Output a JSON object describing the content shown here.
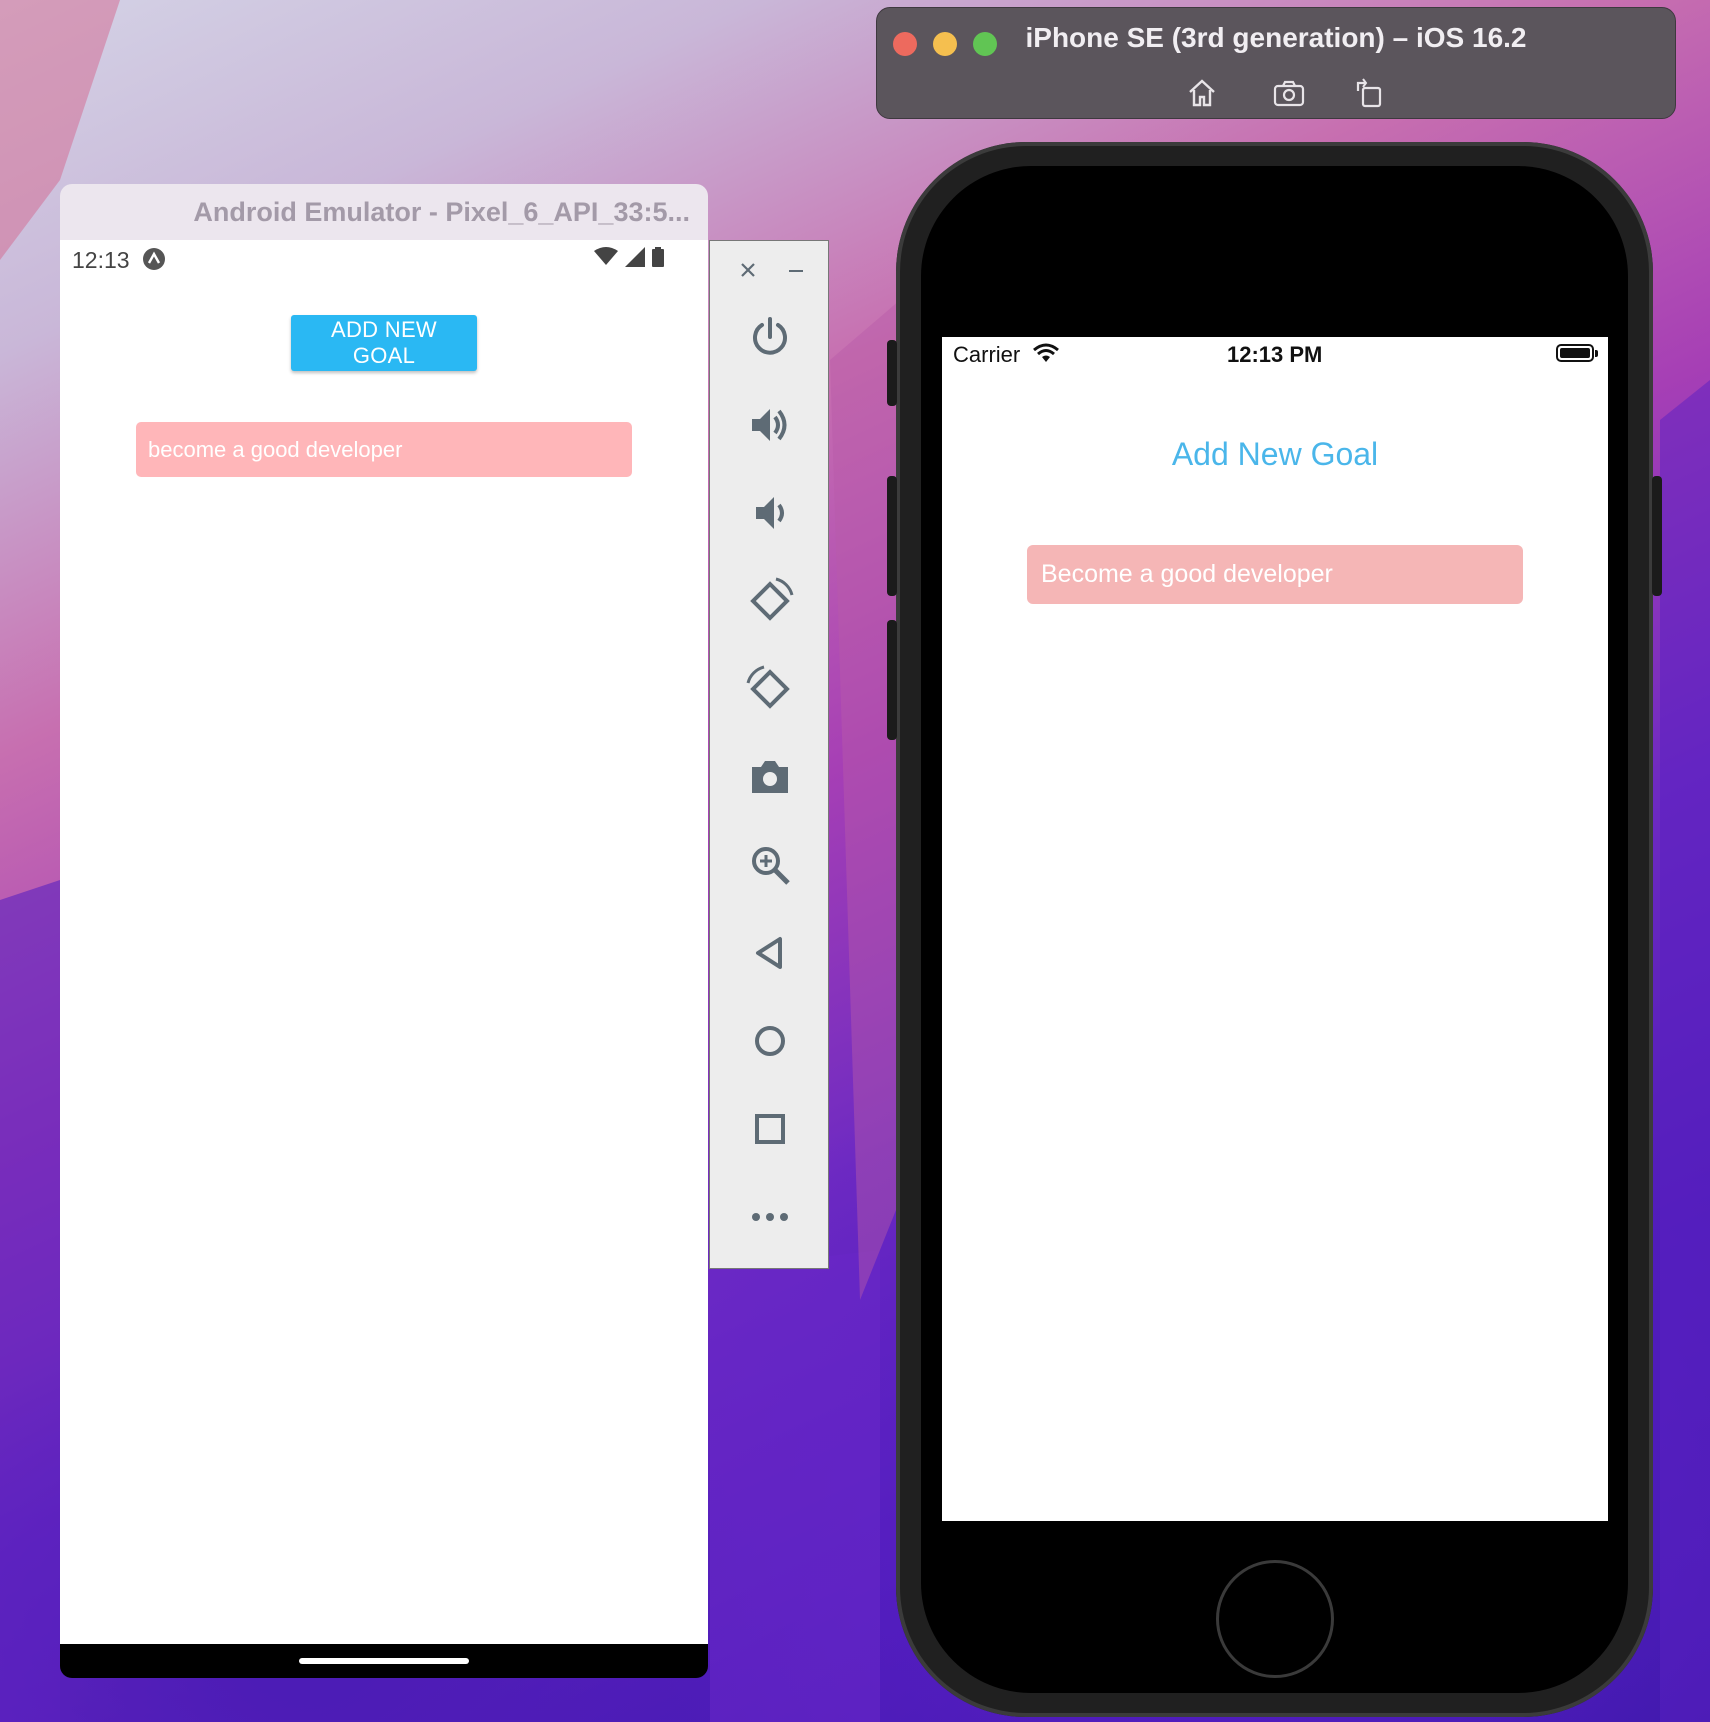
{
  "android": {
    "window_title": "Android Emulator - Pixel_6_API_33:5...",
    "status": {
      "time": "12:13"
    },
    "add_goal_label": "ADD NEW GOAL",
    "goals": [
      "become a good developer"
    ],
    "sidebar": [
      "close-icon",
      "minimize-icon",
      "power-icon",
      "volume-up-icon",
      "volume-down-icon",
      "rotate-left-icon",
      "rotate-right-icon",
      "camera-icon",
      "zoom-icon",
      "back-icon",
      "home-icon",
      "overview-icon",
      "more-icon"
    ]
  },
  "ios": {
    "window_title": "iPhone SE (3rd generation) – iOS 16.2",
    "toolbar": [
      "home-icon",
      "screenshot-icon",
      "rotate-icon"
    ],
    "status": {
      "carrier": "Carrier",
      "time": "12:13 PM"
    },
    "add_goal_label": "Add New Goal",
    "goals": [
      "Become a good developer"
    ]
  },
  "colors": {
    "android_button": "#2ab8f3",
    "goal_background": "#ffb6b9",
    "ios_link": "#4ab6ea"
  }
}
